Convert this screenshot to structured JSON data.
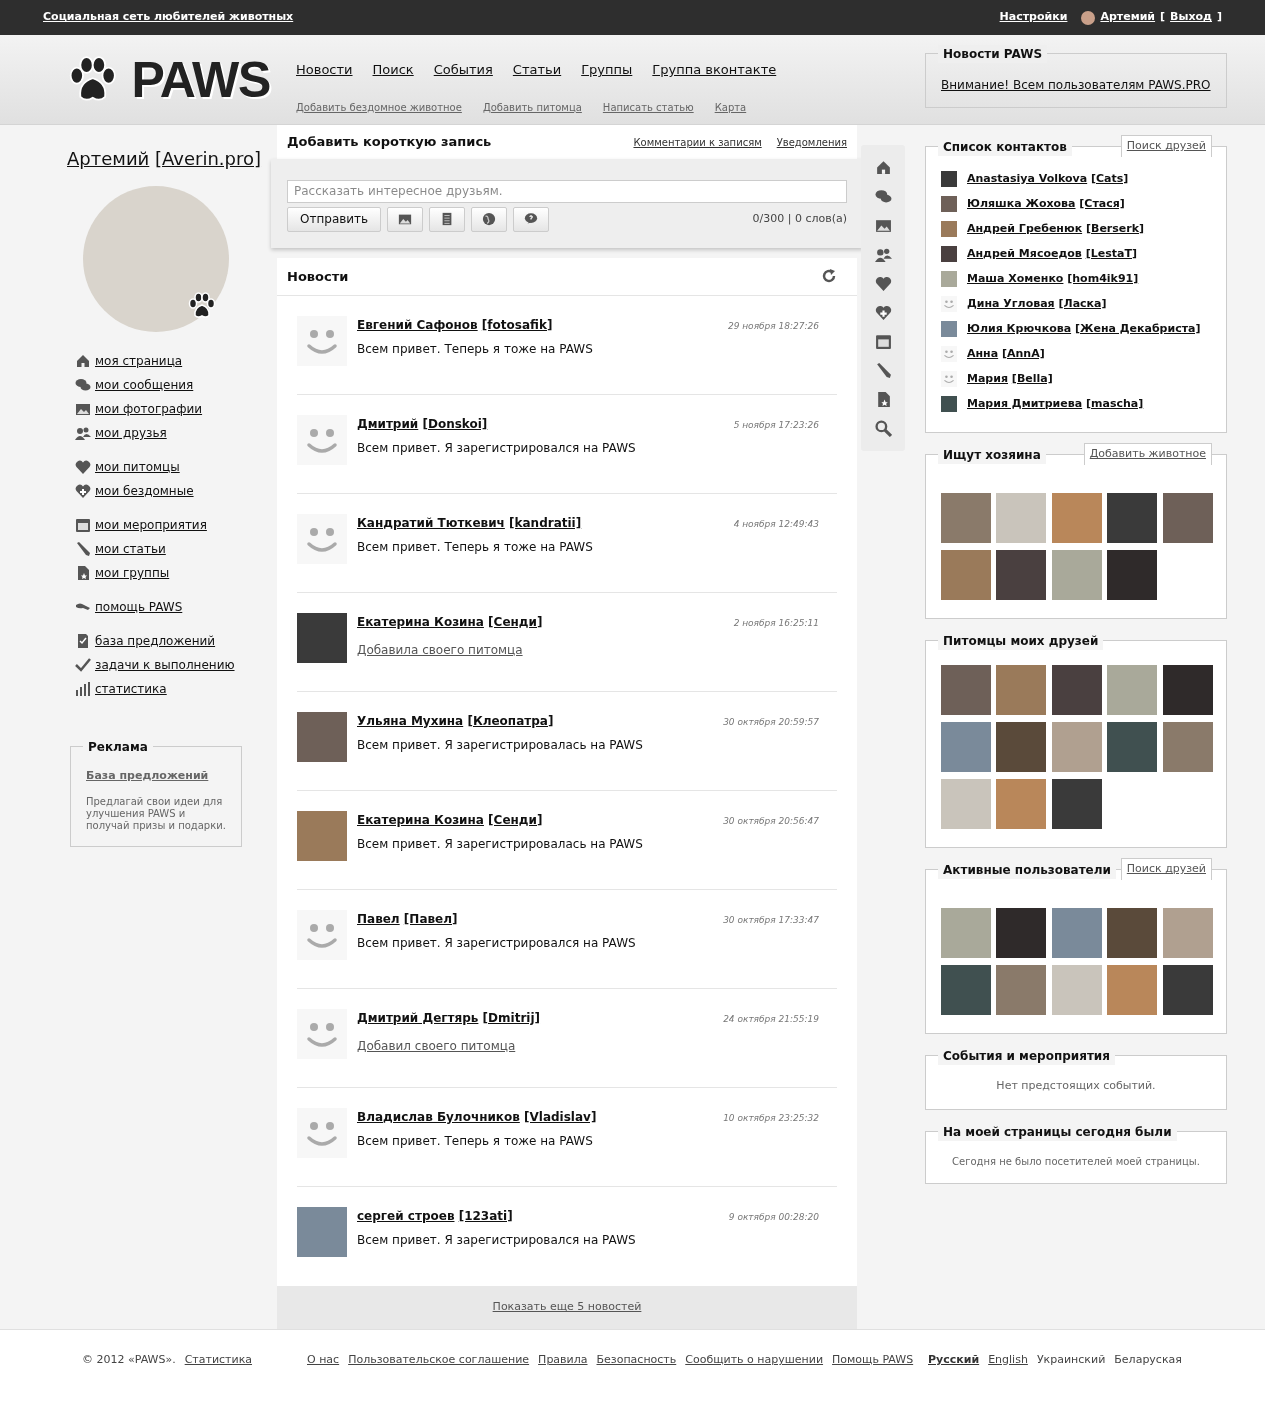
{
  "top_bar": {
    "site_tagline": "Социальная сеть любителей животных",
    "settings": "Настройки",
    "user": "Артемий",
    "logout_open": "[",
    "logout": "Выход",
    "logout_close": "]"
  },
  "header": {
    "logo": "PAWS",
    "main_nav": [
      "Новости",
      "Поиск",
      "События",
      "Статьи",
      "Группы",
      "Группа вконтакте"
    ],
    "sub_nav": [
      "Добавить бездомное животное",
      "Добавить питомца",
      "Написать статью",
      "Карта"
    ],
    "news_box": {
      "title": "Новости PAWS",
      "link": "Внимание! Всем пользователям PAWS.PRO"
    }
  },
  "profile": {
    "name": "Артемий",
    "nick": "[Averin.pro]"
  },
  "sidebar": {
    "groups": [
      [
        "моя страница",
        "мои сообщения",
        "мои фотографии",
        "мои друзья"
      ],
      [
        "мои питомцы",
        "мои бездомные"
      ],
      [
        "мои мероприятия",
        "мои статьи",
        "мои группы"
      ],
      [
        "помощь PAWS"
      ],
      [
        "база предложений",
        "задачи к выполнению",
        "статистика"
      ]
    ]
  },
  "ad": {
    "title": "Реклама",
    "link": "База предложений",
    "text": "Предлагай свои идеи для улучшения PAWS и получай призы и подарки."
  },
  "composer": {
    "title": "Добавить короткую запись",
    "links": [
      "Комментарии к записям",
      "Уведомления"
    ],
    "placeholder": "Рассказать интересное друзьям.",
    "send": "Отправить",
    "counter": "0/300 | 0 слов(а)"
  },
  "feed": {
    "title": "Новости",
    "items": [
      {
        "has_photo": false,
        "name": "Евгений Сафонов",
        "nick": "[fotosafik]",
        "date": "29 ноября 18:27:26",
        "text": "Всем привет. Теперь я тоже на PAWS",
        "kind": "post"
      },
      {
        "has_photo": false,
        "name": "Дмитрий",
        "nick": "[Donskoi]",
        "date": "5 ноября 17:23:26",
        "text": "Всем привет. Я зарегистрировался на PAWS",
        "kind": "post"
      },
      {
        "has_photo": false,
        "name": "Кандратий Тюткевич",
        "nick": "[kandratii]",
        "date": "4 ноября 12:49:43",
        "text": "Всем привет. Теперь я тоже на PAWS",
        "kind": "post"
      },
      {
        "has_photo": true,
        "name": "Екатерина Козина",
        "nick": "[Сенди]",
        "date": "2 ноября 16:25:11",
        "text": "Добавила своего питомца",
        "kind": "activity"
      },
      {
        "has_photo": true,
        "name": "Ульяна Мухина",
        "nick": "[Клеопатра]",
        "date": "30 октября 20:59:57",
        "text": "Всем привет. Я зарегистрировалась на PAWS",
        "kind": "post"
      },
      {
        "has_photo": true,
        "name": "Екатерина Козина",
        "nick": "[Сенди]",
        "date": "30 октября 20:56:47",
        "text": "Всем привет. Я зарегистрировалась на PAWS",
        "kind": "post"
      },
      {
        "has_photo": false,
        "name": "Павел",
        "nick": "[Павел]",
        "date": "30 октября 17:33:47",
        "text": "Всем привет. Я зарегистрировался на PAWS",
        "kind": "post"
      },
      {
        "has_photo": false,
        "name": "Дмитрий Дегтярь",
        "nick": "[Dmitrij]",
        "date": "24 октября 21:55:19",
        "text": "Добавил своего питомца",
        "kind": "activity"
      },
      {
        "has_photo": false,
        "name": "Владислав Булочников",
        "nick": "[Vladislav]",
        "date": "10 октября 23:25:32",
        "text": "Всем привет. Теперь я тоже на PAWS",
        "kind": "post"
      },
      {
        "has_photo": true,
        "name": "сергей строев",
        "nick": "[123ati]",
        "date": "9 октября 00:28:20",
        "text": "Всем привет. Я зарегистрировался на PAWS",
        "kind": "post"
      }
    ],
    "more": "Показать еще 5 новостей"
  },
  "contacts": {
    "title": "Список контактов",
    "action": "Поиск друзей",
    "items": [
      {
        "has_photo": true,
        "name": "Anastasiya Volkova",
        "nick": "[Cats]"
      },
      {
        "has_photo": true,
        "name": "Юляшка Жохова",
        "nick": "[Стася]"
      },
      {
        "has_photo": true,
        "name": "Андрей Гребенюк",
        "nick": "[Berserk]"
      },
      {
        "has_photo": true,
        "name": "Андрей Мясоедов",
        "nick": "[LestaT]"
      },
      {
        "has_photo": true,
        "name": "Маша Хоменко",
        "nick": "[hom4ik91]"
      },
      {
        "has_photo": false,
        "name": "Дина Угловая",
        "nick": "[Ласка]"
      },
      {
        "has_photo": true,
        "name": "Юлия Крючкова",
        "nick": "[Жена Декабриста]"
      },
      {
        "has_photo": false,
        "name": "Анна",
        "nick": "[AnnA]"
      },
      {
        "has_photo": false,
        "name": "Мария",
        "nick": "[Bella]"
      },
      {
        "has_photo": true,
        "name": "Мария Дмитриева",
        "nick": "[mascha]"
      }
    ]
  },
  "homeless": {
    "title": "Ищут хозяина",
    "action": "Добавить животное"
  },
  "friends_pets": {
    "title": "Питомцы моих друзей"
  },
  "active_users": {
    "title": "Активные пользователи",
    "action": "Поиск друзей"
  },
  "events": {
    "title": "События и мероприятия",
    "text": "Нет предстоящих событий."
  },
  "visitors": {
    "title": "На моей страницы сегодня были",
    "text": "Сегодня не было посетителей моей страницы."
  },
  "footer": {
    "copyright": "© 2012 «PAWS».",
    "stats": "Статистика",
    "links": [
      "О нас",
      "Пользовательское соглашение",
      "Правила",
      "Безопасность",
      "Сообщить о нарушении",
      "Помощь PAWS"
    ],
    "languages": [
      {
        "label": "Русский",
        "selected": true
      },
      {
        "label": "English",
        "selected": false
      },
      {
        "label": "Украинский",
        "selected": false
      },
      {
        "label": "Беларуская",
        "selected": false
      }
    ]
  }
}
